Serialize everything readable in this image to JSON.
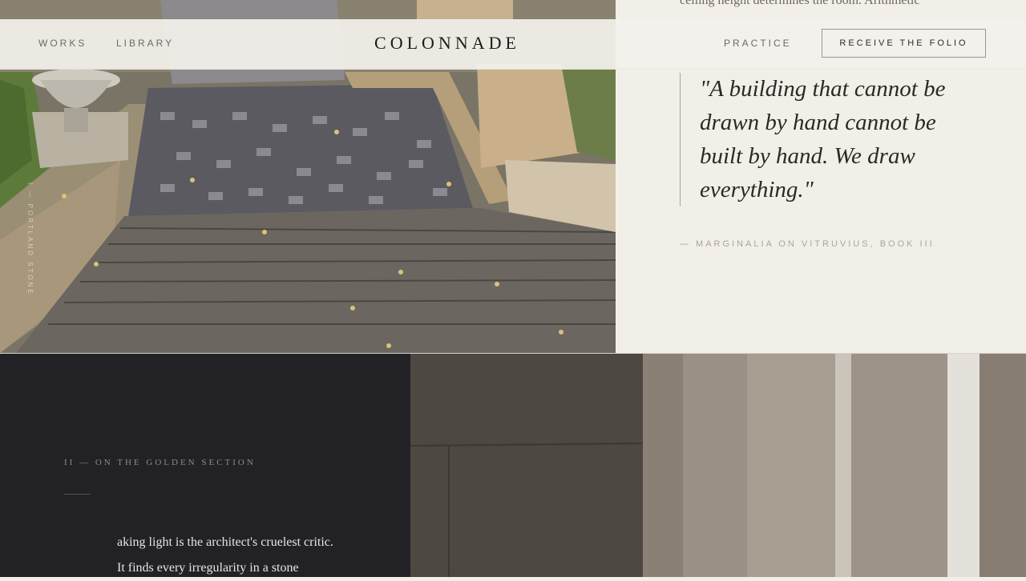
{
  "header": {
    "nav_left": [
      "WORKS",
      "LIBRARY"
    ],
    "brand": "COLONNADE",
    "nav_right": "PRACTICE",
    "cta": "RECEIVE THE FOLIO"
  },
  "hero": {
    "image": "stone-stairs-photo",
    "caption": "I — PORTLAND STONE"
  },
  "quote_panel": {
    "prev_text": "ceiling height determines the room. Arithmetic",
    "quote": "\"A building that cannot be drawn by hand cannot be built by hand. We draw everything.\"",
    "citation": "— MARGINALIA ON VITRUVIUS, BOOK III"
  },
  "section": {
    "label": "II — ON THE GOLDEN SECTION",
    "body_line_1": "aking light is the architect's cruelest critic.",
    "body_line_2": "It finds every irregularity in a stone",
    "image": "fluted-column-photo"
  },
  "colors": {
    "paper": "#f2efe9",
    "ink": "#1d1c1a",
    "dark_panel": "#222226"
  }
}
